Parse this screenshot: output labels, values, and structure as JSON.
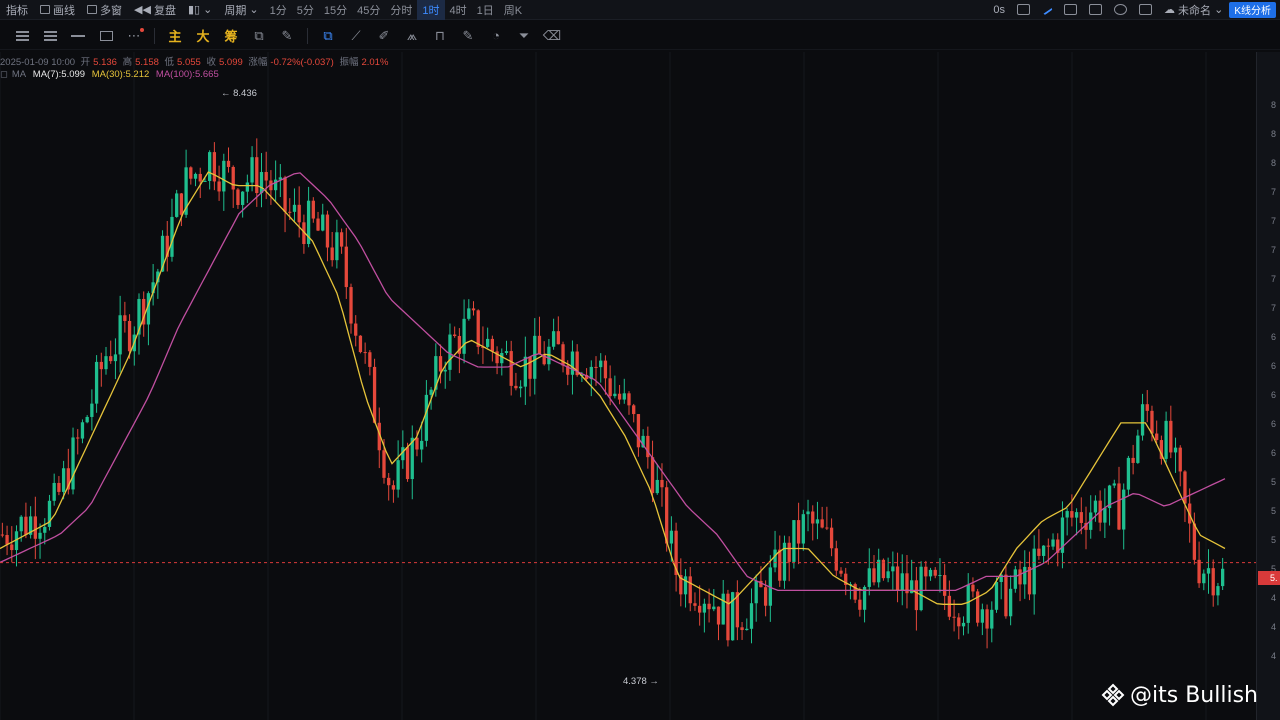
{
  "topbar": {
    "items": [
      "指标",
      "画线",
      "多窗",
      "复盘"
    ],
    "more_label": "周期",
    "periods": [
      "1分",
      "5分",
      "15分",
      "45分",
      "分时",
      "1时",
      "4时",
      "1日",
      "周K"
    ],
    "active_period": "1时",
    "right_text": "0s",
    "layout_name": "未命名",
    "k_analysis_label": "K线分析"
  },
  "toolbar": {
    "text_tools": [
      "主",
      "大",
      "筹"
    ]
  },
  "ohlc": {
    "date": "2025-01-09 10:00",
    "open_label": "开",
    "open": "5.136",
    "high_label": "高",
    "high": "5.158",
    "low_label": "低",
    "low": "5.055",
    "close_label": "收",
    "close": "5.099",
    "change_label": "涨幅",
    "change": "-0.72%(-0.037)",
    "amp_label": "振幅",
    "amp": "2.01%"
  },
  "ma": {
    "label": "MA",
    "ma7": "MA(7):5.099",
    "ma30": "MA(30):5.212",
    "ma100": "MA(100):5.665",
    "colors": {
      "ma7": "#ffffff",
      "ma30": "#e5c33a",
      "ma100": "#c04fa0"
    }
  },
  "annotations": {
    "high": "← 8.436",
    "low": "4.378 →"
  },
  "axis": {
    "labels": [
      "8",
      "8",
      "8",
      "7",
      "7",
      "7",
      "7",
      "7",
      "6",
      "6",
      "6",
      "6",
      "6",
      "5",
      "5",
      "5",
      "5",
      "4",
      "4",
      "4"
    ],
    "current_price": "5."
  },
  "colors": {
    "up": "#1fbf8f",
    "down": "#e5483b",
    "bg": "#0b0c0f",
    "accent": "#3d8bff"
  },
  "watermark": "@its Bullish",
  "chart_data": {
    "type": "candlestick",
    "series": [
      {
        "name": "MA(7)",
        "values": [
          5.3,
          5.4,
          5.5,
          6.0,
          6.6,
          6.8,
          7.2,
          7.8,
          8.0,
          7.8,
          7.9,
          7.6,
          7.5,
          7.3,
          6.5,
          5.6,
          6.0,
          6.6,
          6.8,
          6.6,
          6.5,
          6.6,
          6.6,
          6.5,
          6.2,
          5.8,
          5.0,
          4.9,
          4.7,
          4.8,
          5.1,
          5.4,
          5.2,
          4.9,
          5.0,
          4.9,
          4.9,
          4.8,
          4.8,
          4.9,
          5.1,
          5.4,
          5.5,
          5.5,
          6.2,
          5.9,
          5.1,
          5.0
        ]
      },
      {
        "name": "MA(30)",
        "values": [
          5.2,
          5.3,
          5.4,
          5.8,
          6.2,
          6.6,
          7.1,
          7.6,
          7.9,
          7.8,
          7.8,
          7.6,
          7.4,
          7.0,
          6.3,
          5.8,
          6.0,
          6.5,
          6.7,
          6.6,
          6.5,
          6.6,
          6.5,
          6.3,
          6.0,
          5.6,
          5.0,
          4.9,
          4.8,
          5.0,
          5.2,
          5.2,
          5.0,
          4.9,
          4.9,
          4.9,
          4.8,
          4.8,
          4.9,
          5.2,
          5.4,
          5.5,
          5.8,
          6.1,
          6.1,
          5.7,
          5.3,
          5.2
        ]
      },
      {
        "name": "MA(100)",
        "values": [
          5.1,
          5.2,
          5.3,
          5.5,
          5.9,
          6.3,
          6.8,
          7.2,
          7.6,
          7.8,
          7.9,
          7.7,
          7.4,
          7.0,
          6.8,
          6.6,
          6.5,
          6.5,
          6.6,
          6.5,
          6.4,
          6.1,
          5.8,
          5.5,
          5.3,
          5.0,
          4.9,
          4.9,
          4.9,
          4.9,
          4.9,
          4.9,
          4.9,
          5.0,
          5.0,
          5.1,
          5.3,
          5.5,
          5.6,
          5.5,
          5.6,
          5.7
        ]
      }
    ],
    "high_value": 8.436,
    "low_value": 4.378,
    "last_close": 5.099,
    "ylim": [
      4.1,
      8.6
    ]
  }
}
